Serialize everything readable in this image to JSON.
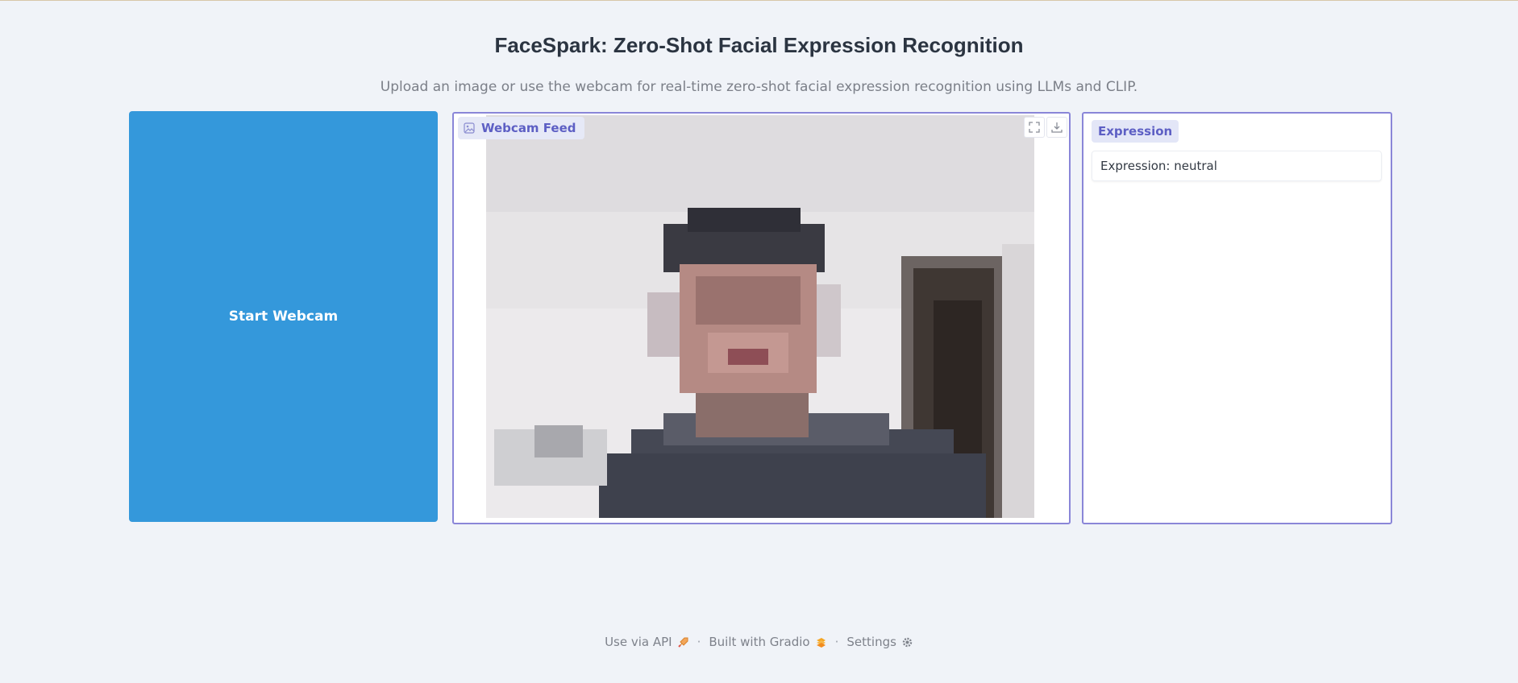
{
  "header": {
    "title": "FaceSpark: Zero-Shot Facial Expression Recognition",
    "subtitle": "Upload an image or use the webcam for real-time zero-shot facial expression recognition using LLMs and CLIP."
  },
  "controls": {
    "start_label": "Start Webcam",
    "accent_color": "#3498db"
  },
  "webcam": {
    "label": "Webcam Feed",
    "label_icon": "image-icon",
    "tools": [
      "fullscreen-icon",
      "download-icon"
    ]
  },
  "expression": {
    "label": "Expression",
    "value": "Expression: neutral"
  },
  "footer": {
    "api_label": "Use via API",
    "built_label": "Built with Gradio",
    "settings_label": "Settings",
    "separator": "·"
  },
  "colors": {
    "panel_border": "#8a86d8",
    "label_text": "#5d5fc4"
  }
}
